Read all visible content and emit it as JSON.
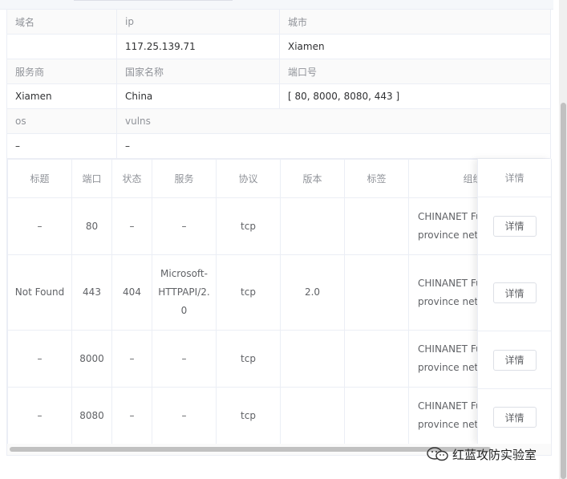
{
  "info": {
    "labels_row1": [
      "域名",
      "ip",
      "城市"
    ],
    "values_row1": [
      "",
      "117.25.139.71",
      "Xiamen"
    ],
    "labels_row2": [
      "服务商",
      "国家名称",
      "端口号"
    ],
    "values_row2": [
      "Xiamen",
      "China",
      "[ 80, 8000, 8080, 443 ]"
    ],
    "labels_row3": [
      "os",
      "vulns"
    ],
    "values_row3": [
      "–",
      "–"
    ]
  },
  "ports": {
    "headers": [
      "标题",
      "端口",
      "状态",
      "服务",
      "协议",
      "版本",
      "标签",
      "组织"
    ],
    "detail_header": "详情",
    "rows": [
      {
        "title": "–",
        "port": "80",
        "status": "–",
        "service": "–",
        "protocol": "tcp",
        "version": "",
        "tags": "",
        "org_line1": "CHINANET Fujian",
        "org_line2": "province network",
        "detail": "详情"
      },
      {
        "title": "Not Found",
        "port": "443",
        "status": "404",
        "service": "Microsoft-HTTPAPI/2.0",
        "protocol": "tcp",
        "version": "2.0",
        "tags": "",
        "org_line1": "CHINANET Fujian",
        "org_line2": "province network",
        "detail": "详情"
      },
      {
        "title": "–",
        "port": "8000",
        "status": "–",
        "service": "–",
        "protocol": "tcp",
        "version": "",
        "tags": "",
        "org_line1": "CHINANET Fujian",
        "org_line2": "province network",
        "detail": "详情"
      },
      {
        "title": "–",
        "port": "8080",
        "status": "–",
        "service": "–",
        "protocol": "tcp",
        "version": "",
        "tags": "",
        "org_line1": "CHINANET Fujian",
        "org_line2": "province network",
        "detail": "详情"
      }
    ]
  },
  "watermark": {
    "text": "红蓝攻防实验室",
    "icon": "wechat-icon"
  }
}
